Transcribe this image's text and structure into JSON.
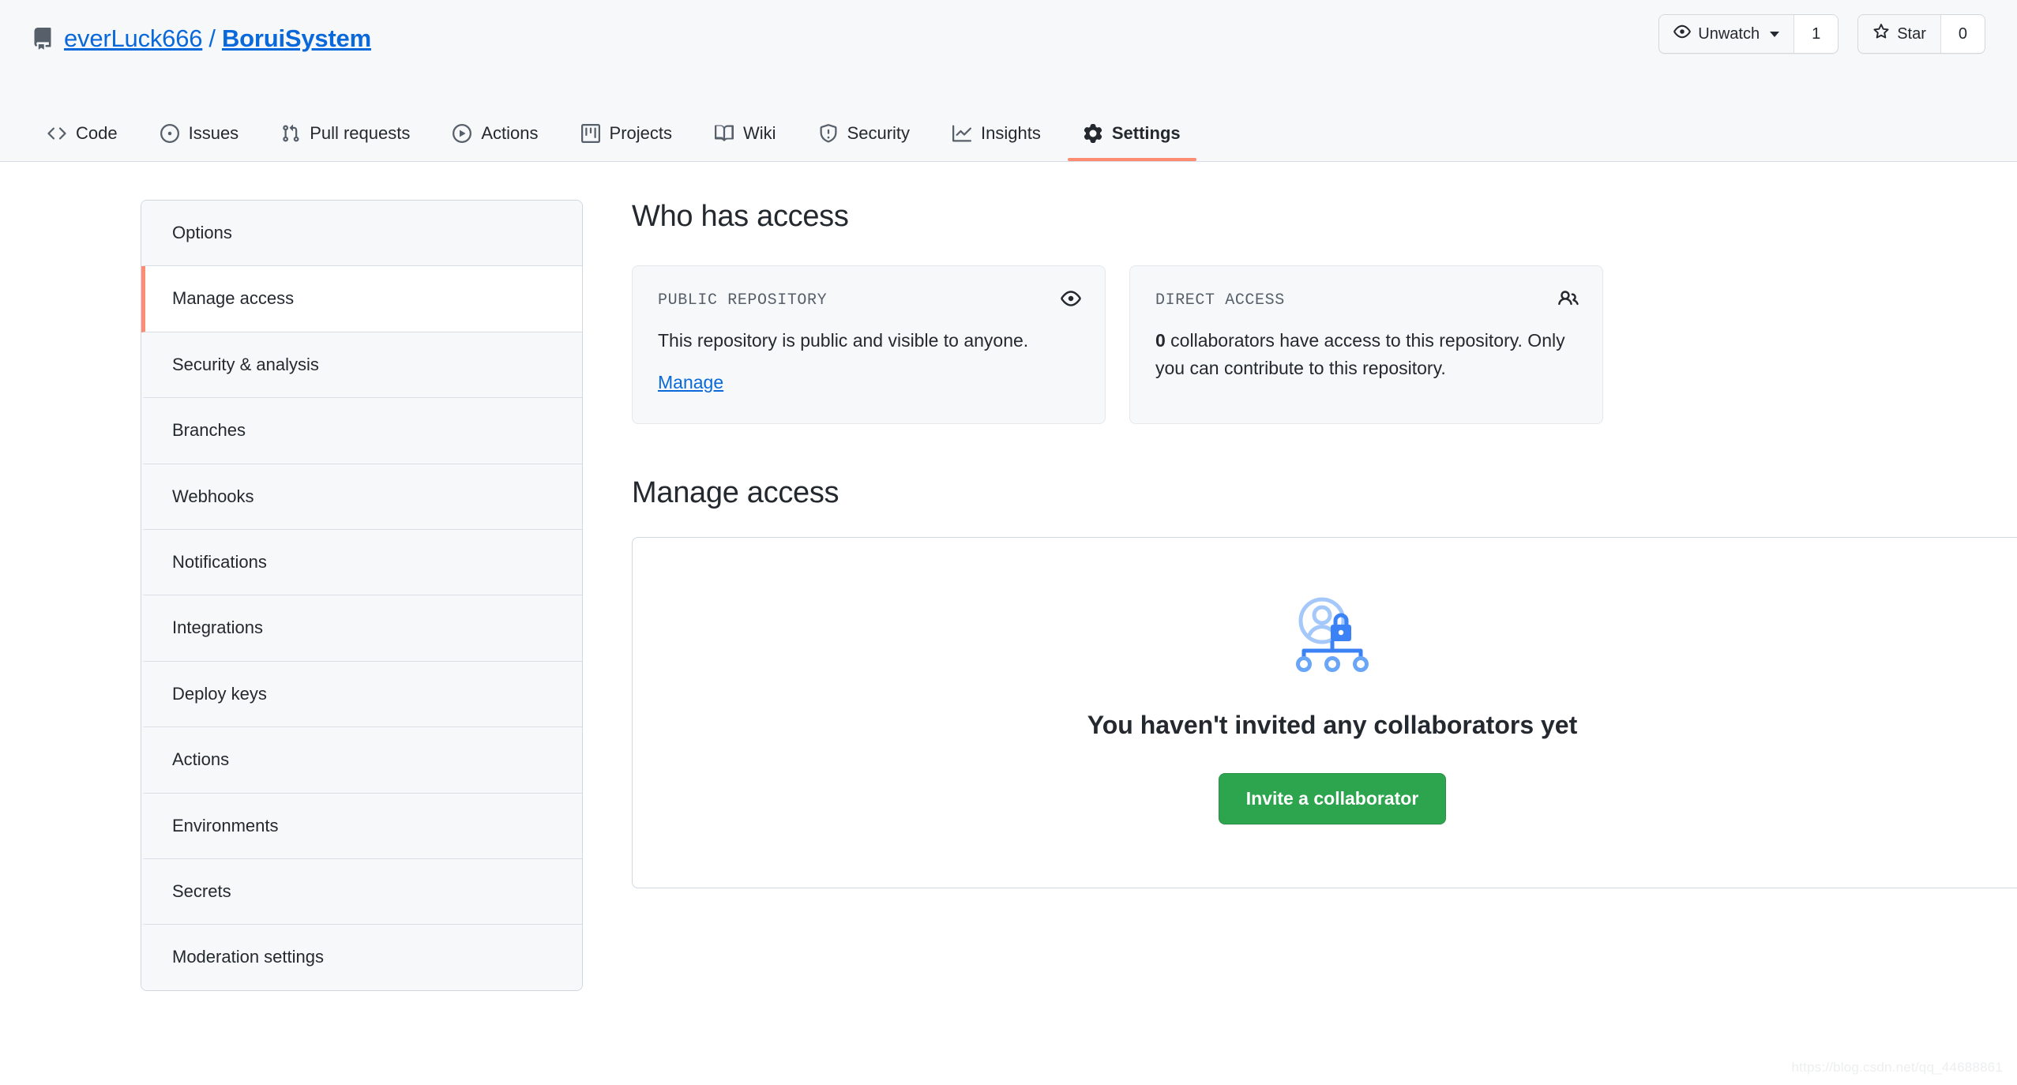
{
  "header": {
    "repo_icon": "repo-book-icon",
    "owner": "everLuck666",
    "separator": "/",
    "repo": "BoruiSystem",
    "watch": {
      "icon": "eye-icon",
      "label": "Unwatch",
      "count": "1"
    },
    "star": {
      "icon": "star-icon",
      "label": "Star",
      "count": "0"
    }
  },
  "nav": {
    "tabs": [
      {
        "label": "Code",
        "icon": "code-icon",
        "active": false
      },
      {
        "label": "Issues",
        "icon": "issue-opened-icon",
        "active": false
      },
      {
        "label": "Pull requests",
        "icon": "git-pull-request-icon",
        "active": false
      },
      {
        "label": "Actions",
        "icon": "play-circle-icon",
        "active": false
      },
      {
        "label": "Projects",
        "icon": "project-board-icon",
        "active": false
      },
      {
        "label": "Wiki",
        "icon": "book-icon",
        "active": false
      },
      {
        "label": "Security",
        "icon": "shield-icon",
        "active": false
      },
      {
        "label": "Insights",
        "icon": "graph-icon",
        "active": false
      },
      {
        "label": "Settings",
        "icon": "gear-icon",
        "active": true
      }
    ],
    "active_underline_color": "#fd8c73"
  },
  "sidebar": {
    "items": [
      {
        "label": "Options",
        "selected": false
      },
      {
        "label": "Manage access",
        "selected": true
      },
      {
        "label": "Security & analysis",
        "selected": false
      },
      {
        "label": "Branches",
        "selected": false
      },
      {
        "label": "Webhooks",
        "selected": false
      },
      {
        "label": "Notifications",
        "selected": false
      },
      {
        "label": "Integrations",
        "selected": false
      },
      {
        "label": "Deploy keys",
        "selected": false
      },
      {
        "label": "Actions",
        "selected": false
      },
      {
        "label": "Environments",
        "selected": false
      },
      {
        "label": "Secrets",
        "selected": false
      },
      {
        "label": "Moderation settings",
        "selected": false
      }
    ]
  },
  "main": {
    "who_has_access_title": "Who has access",
    "cards": [
      {
        "label": "PUBLIC REPOSITORY",
        "icon": "eye-icon",
        "text": "This repository is public and visible to anyone.",
        "link": "Manage"
      },
      {
        "label": "DIRECT ACCESS",
        "icon": "people-icon",
        "count": "0",
        "text_rest": " collaborators have access to this repository. Only you can contribute to this repository."
      }
    ],
    "manage_access_title": "Manage access",
    "empty_state": {
      "illustration": "person-lock-org-chart-illustration",
      "heading": "You haven't invited any collaborators yet",
      "button": "Invite a collaborator",
      "button_color": "#2da44e"
    }
  },
  "watermark": "https://blog.csdn.net/qq_44688861"
}
